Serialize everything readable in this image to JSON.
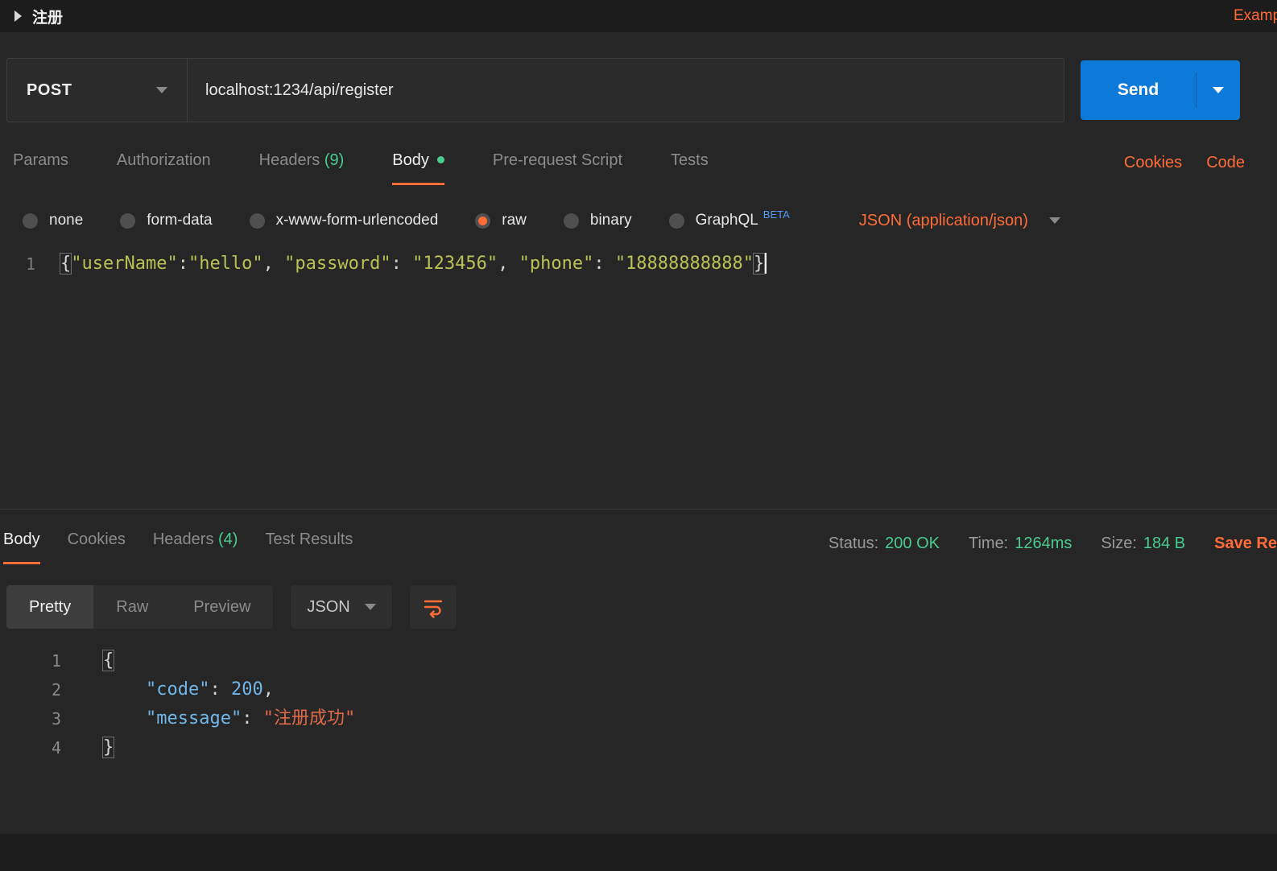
{
  "colors": {
    "accent_orange": "#ff6c37",
    "success_green": "#49cc90",
    "send_blue": "#0d79d8",
    "beta_blue": "#539bf5",
    "request_string": "#b9c154",
    "response_key": "#71b6e8",
    "response_string": "#e0694a"
  },
  "topbar": {
    "tab_title": "注册",
    "examples_label": "Examples"
  },
  "request": {
    "method": "POST",
    "url": "localhost:1234/api/register",
    "send_label": "Send",
    "tabs": [
      {
        "label": "Params"
      },
      {
        "label": "Authorization"
      },
      {
        "label": "Headers",
        "count": " (9)"
      },
      {
        "label": "Body"
      },
      {
        "label": "Pre-request Script"
      },
      {
        "label": "Tests"
      }
    ],
    "cookies_link": "Cookies",
    "code_link": "Code",
    "body_modes": {
      "none": "none",
      "form_data": "form-data",
      "urlencoded": "x-www-form-urlencoded",
      "raw": "raw",
      "binary": "binary",
      "graphql": "GraphQL",
      "beta_badge": "BETA",
      "selected": "raw",
      "content_type": "JSON (application/json)"
    },
    "editor": {
      "line_number": "1",
      "tokens": [
        {
          "type": "punct-hl",
          "text": "{"
        },
        {
          "type": "string",
          "text": "\"userName\""
        },
        {
          "type": "punct",
          "text": ":"
        },
        {
          "type": "string",
          "text": "\"hello\""
        },
        {
          "type": "punct",
          "text": ", "
        },
        {
          "type": "string",
          "text": "\"password\""
        },
        {
          "type": "punct",
          "text": ": "
        },
        {
          "type": "string",
          "text": "\"123456\""
        },
        {
          "type": "punct",
          "text": ", "
        },
        {
          "type": "string",
          "text": "\"phone\""
        },
        {
          "type": "punct",
          "text": ": "
        },
        {
          "type": "string",
          "text": "\"18888888888\""
        },
        {
          "type": "punct-hl",
          "text": "}"
        }
      ]
    }
  },
  "response": {
    "tabs": [
      {
        "label": "Body"
      },
      {
        "label": "Cookies"
      },
      {
        "label": "Headers",
        "count": " (4)"
      },
      {
        "label": "Test Results"
      }
    ],
    "status_label": "Status:",
    "status_value": "200 OK",
    "time_label": "Time:",
    "time_value": "1264ms",
    "size_label": "Size:",
    "size_value": "184 B",
    "save_label": "Save Response",
    "modes": {
      "pretty": "Pretty",
      "raw": "Raw",
      "preview": "Preview"
    },
    "active_mode": "Pretty",
    "format": "JSON",
    "lines": [
      {
        "num": "1",
        "tokens": [
          {
            "type": "punct-hl",
            "text": "{"
          }
        ]
      },
      {
        "num": "2",
        "tokens": [
          {
            "type": "punct",
            "text": "    "
          },
          {
            "type": "key",
            "text": "\"code\""
          },
          {
            "type": "punct",
            "text": ": "
          },
          {
            "type": "number",
            "text": "200"
          },
          {
            "type": "punct",
            "text": ","
          }
        ]
      },
      {
        "num": "3",
        "tokens": [
          {
            "type": "punct",
            "text": "    "
          },
          {
            "type": "key",
            "text": "\"message\""
          },
          {
            "type": "punct",
            "text": ": "
          },
          {
            "type": "string",
            "text": "\"注册成功\""
          }
        ]
      },
      {
        "num": "4",
        "tokens": [
          {
            "type": "punct-hl",
            "text": "}"
          }
        ]
      }
    ]
  }
}
